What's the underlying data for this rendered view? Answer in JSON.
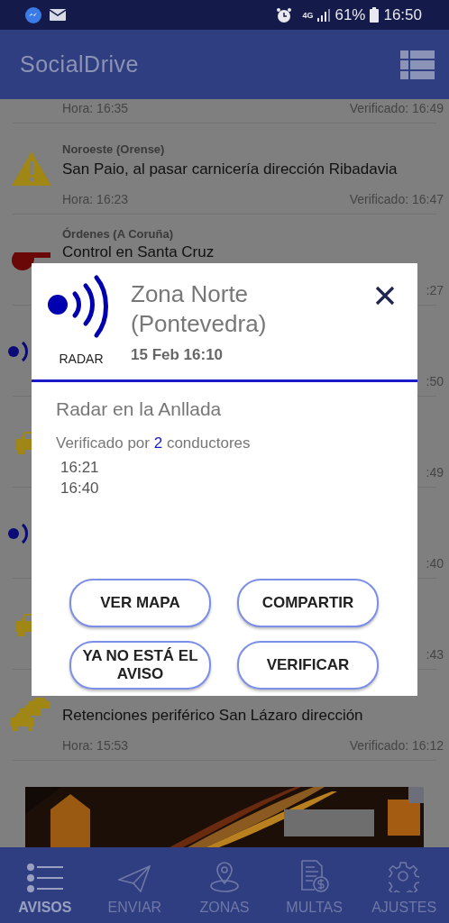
{
  "status_bar": {
    "network": "4G",
    "battery": "61%",
    "time": "16:50"
  },
  "app_bar": {
    "title": "SocialDrive"
  },
  "alerts": [
    {
      "kind": "none",
      "hora": "Hora: 16:35",
      "verificado": "Verificado: 16:49"
    },
    {
      "kind": "warning",
      "region": "Noroeste (Orense)",
      "title": "San Paio, al pasar carnicería dirección Ribadavia",
      "hora": "Hora: 16:23",
      "verificado": "Verificado: 16:47"
    },
    {
      "kind": "whistle",
      "region": "Órdenes (A Coruña)",
      "title": "Control en Santa Cruz",
      "verificado": ":27"
    },
    {
      "kind": "radar",
      "verificado": ":50"
    },
    {
      "kind": "car",
      "verificado": ":49"
    },
    {
      "kind": "radar",
      "verificado": ":40"
    },
    {
      "kind": "car",
      "verificado": ":43"
    },
    {
      "kind": "jam",
      "title": "Retenciones periférico San Lázaro dirección",
      "hora": "Hora: 15:53",
      "verificado": "Verificado: 16:12"
    }
  ],
  "nav": [
    {
      "label": "AVISOS",
      "selected": true
    },
    {
      "label": "ENVIAR",
      "selected": false
    },
    {
      "label": "ZONAS",
      "selected": false
    },
    {
      "label": "MULTAS",
      "selected": false
    },
    {
      "label": "AJUSTES",
      "selected": false
    }
  ],
  "dialog": {
    "category": "RADAR",
    "zone": "Zona Norte (Pontevedra)",
    "date": "15 Feb 16:10",
    "description": "Radar en la Anllada",
    "verified_prefix": "Verificado por",
    "verified_count": "2",
    "verified_suffix": "conductores",
    "times": [
      "16:21",
      "16:40"
    ],
    "buttons": [
      "VER MAPA",
      "COMPARTIR",
      "YA NO ESTÁ EL AVISO",
      "VERIFICAR"
    ]
  }
}
